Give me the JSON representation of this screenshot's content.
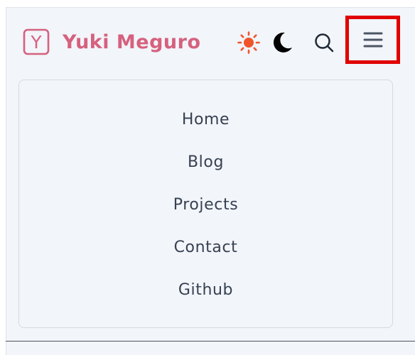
{
  "header": {
    "site_title": "Yuki Meguro",
    "logo_letter": "Y",
    "brand_color": "#d6617e"
  },
  "toolbar": {
    "light_mode_icon": "sun-icon",
    "dark_mode_icon": "moon-icon",
    "search_icon": "search-icon",
    "menu_icon": "hamburger-menu-icon",
    "sun_color": "#f0552a",
    "highlight_color": "#e00000"
  },
  "nav": {
    "items": [
      {
        "label": "Home"
      },
      {
        "label": "Blog"
      },
      {
        "label": "Projects"
      },
      {
        "label": "Contact"
      },
      {
        "label": "Github"
      }
    ]
  }
}
